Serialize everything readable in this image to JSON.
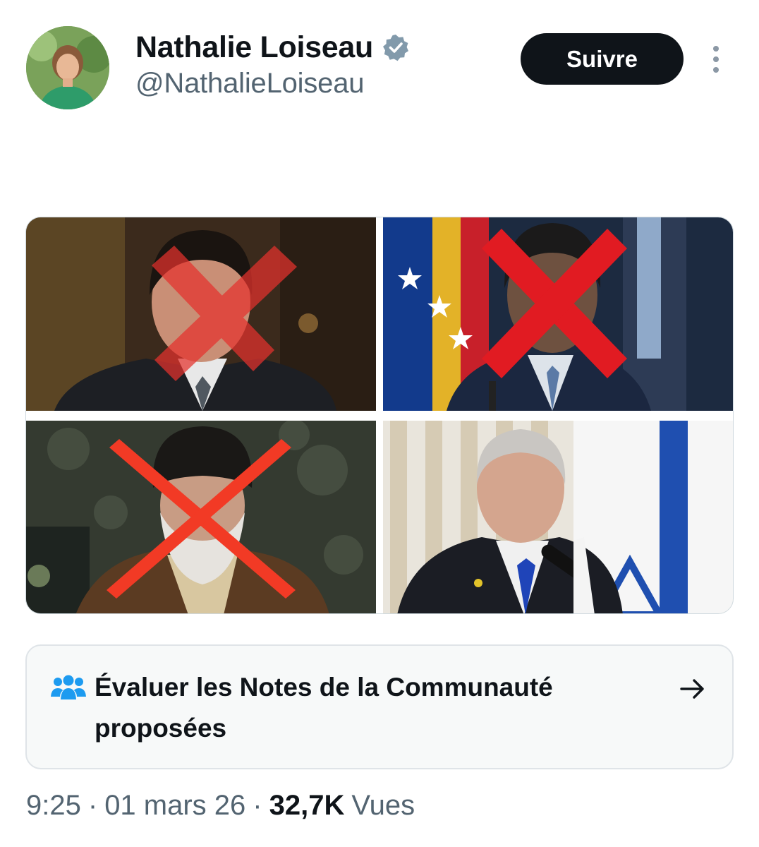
{
  "author": {
    "display_name": "Nathalie Loiseau",
    "handle": "@NathalieLoiseau",
    "verified": true
  },
  "actions": {
    "follow_label": "Suivre"
  },
  "media": [
    {
      "crossed_out": true,
      "cross_color": "#e5322d"
    },
    {
      "crossed_out": true,
      "cross_color": "#e11b22"
    },
    {
      "crossed_out": true,
      "cross_color": "#f23a25"
    },
    {
      "crossed_out": false
    }
  ],
  "community_notes": {
    "label": "Évaluer les Notes de la Communauté proposées",
    "icon": "people-icon",
    "accent_color": "#1d9bf0"
  },
  "meta": {
    "time": "9:25",
    "separator": "·",
    "date": "01 mars 26",
    "views_count": "32,7K",
    "views_label": "Vues"
  },
  "colors": {
    "text_primary": "#0f1419",
    "text_secondary": "#536471",
    "verified_badge": "#829aab"
  }
}
